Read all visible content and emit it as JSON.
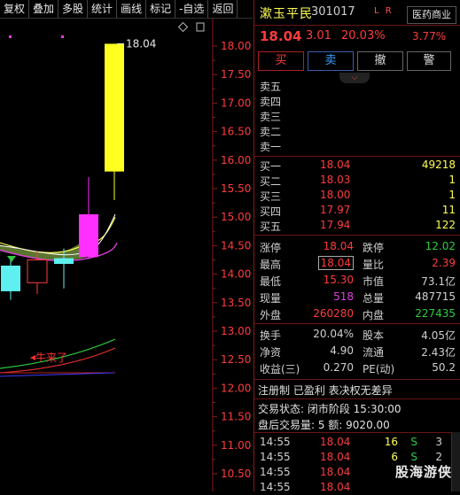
{
  "toolbar": [
    "复权",
    "叠加",
    "多股",
    "统计",
    "画线",
    "标记",
    "-自选",
    "返回"
  ],
  "chart_data": {
    "type": "candlestick",
    "y_ticks": [
      "18.00",
      "17.50",
      "17.00",
      "16.50",
      "16.00",
      "15.50",
      "15.00",
      "14.50",
      "14.00",
      "13.50",
      "13.00",
      "12.50",
      "12.00",
      "11.50",
      "11.00",
      "10.50"
    ],
    "high_label": "18.04",
    "annotation": "牛来了",
    "candles": [
      {
        "open": 13.7,
        "close": 14.15,
        "high": 14.25,
        "low": 13.55,
        "color": "cyan"
      },
      {
        "open": 14.25,
        "close": 13.85,
        "high": 14.4,
        "low": 13.65,
        "color": "red-hollow"
      },
      {
        "open": 14.18,
        "close": 14.28,
        "high": 14.45,
        "low": 13.75,
        "color": "cyan"
      },
      {
        "open": 14.3,
        "close": 15.05,
        "high": 15.7,
        "low": 14.28,
        "color": "magenta"
      },
      {
        "open": 15.8,
        "close": 18.04,
        "high": 18.04,
        "low": 15.3,
        "color": "yellow"
      }
    ]
  },
  "quote": {
    "name": "漱玉平民",
    "code": "301017",
    "tags": "L R",
    "industry": "医药商业",
    "price": "18.04",
    "change": "3.01",
    "pct": "20.03%",
    "turnover_pct": "3.77%"
  },
  "trade_buttons": {
    "buy": "买",
    "sell": "卖",
    "cancel": "撤",
    "warn": "警"
  },
  "asks": [
    {
      "label": "卖五",
      "price": "",
      "vol": ""
    },
    {
      "label": "卖四",
      "price": "",
      "vol": ""
    },
    {
      "label": "卖三",
      "price": "",
      "vol": ""
    },
    {
      "label": "卖二",
      "price": "",
      "vol": ""
    },
    {
      "label": "卖一",
      "price": "",
      "vol": ""
    }
  ],
  "bids": [
    {
      "label": "买一",
      "price": "18.04",
      "vol": "49218"
    },
    {
      "label": "买二",
      "price": "18.03",
      "vol": "1"
    },
    {
      "label": "买三",
      "price": "18.00",
      "vol": "1"
    },
    {
      "label": "买四",
      "price": "17.97",
      "vol": "11"
    },
    {
      "label": "买五",
      "price": "17.94",
      "vol": "122"
    }
  ],
  "stats1": [
    {
      "l1": "涨停",
      "v1": "18.04",
      "l2": "跌停",
      "v2": "12.02"
    },
    {
      "l1": "最高",
      "v1": "18.04",
      "l2": "量比",
      "v2": "2.39"
    },
    {
      "l1": "最低",
      "v1": "15.30",
      "l2": "市值",
      "v2": "73.1亿"
    },
    {
      "l1": "现量",
      "v1": "518",
      "l2": "总量",
      "v2": "487715"
    },
    {
      "l1": "外盘",
      "v1": "260280",
      "l2": "内盘",
      "v2": "227435"
    }
  ],
  "stats2": [
    {
      "l1": "换手",
      "v1": "20.04%",
      "l2": "股本",
      "v2": "4.05亿"
    },
    {
      "l1": "净资",
      "v1": "4.90",
      "l2": "流通",
      "v2": "2.43亿"
    },
    {
      "l1": "收益(三)",
      "v1": "0.270",
      "l2": "PE(动)",
      "v2": "50.2"
    }
  ],
  "info": {
    "line1": "注册制 已盈利 表决权无差异",
    "line2": "交易状态: 闭市阶段 15:30:00",
    "line3": "盘后交易量: 5  额: 9020.00"
  },
  "ticks": [
    {
      "time": "14:55",
      "price": "18.04",
      "vol": "16",
      "side": "S",
      "n": "3"
    },
    {
      "time": "14:55",
      "price": "18.04",
      "vol": "6",
      "side": "S",
      "n": "2"
    },
    {
      "time": "14:55",
      "price": "18.04",
      "vol": "",
      "side": "",
      "n": ""
    },
    {
      "time": "14:55",
      "price": "18.04",
      "vol": "",
      "side": "",
      "n": ""
    }
  ],
  "watermark": "股海游侠"
}
